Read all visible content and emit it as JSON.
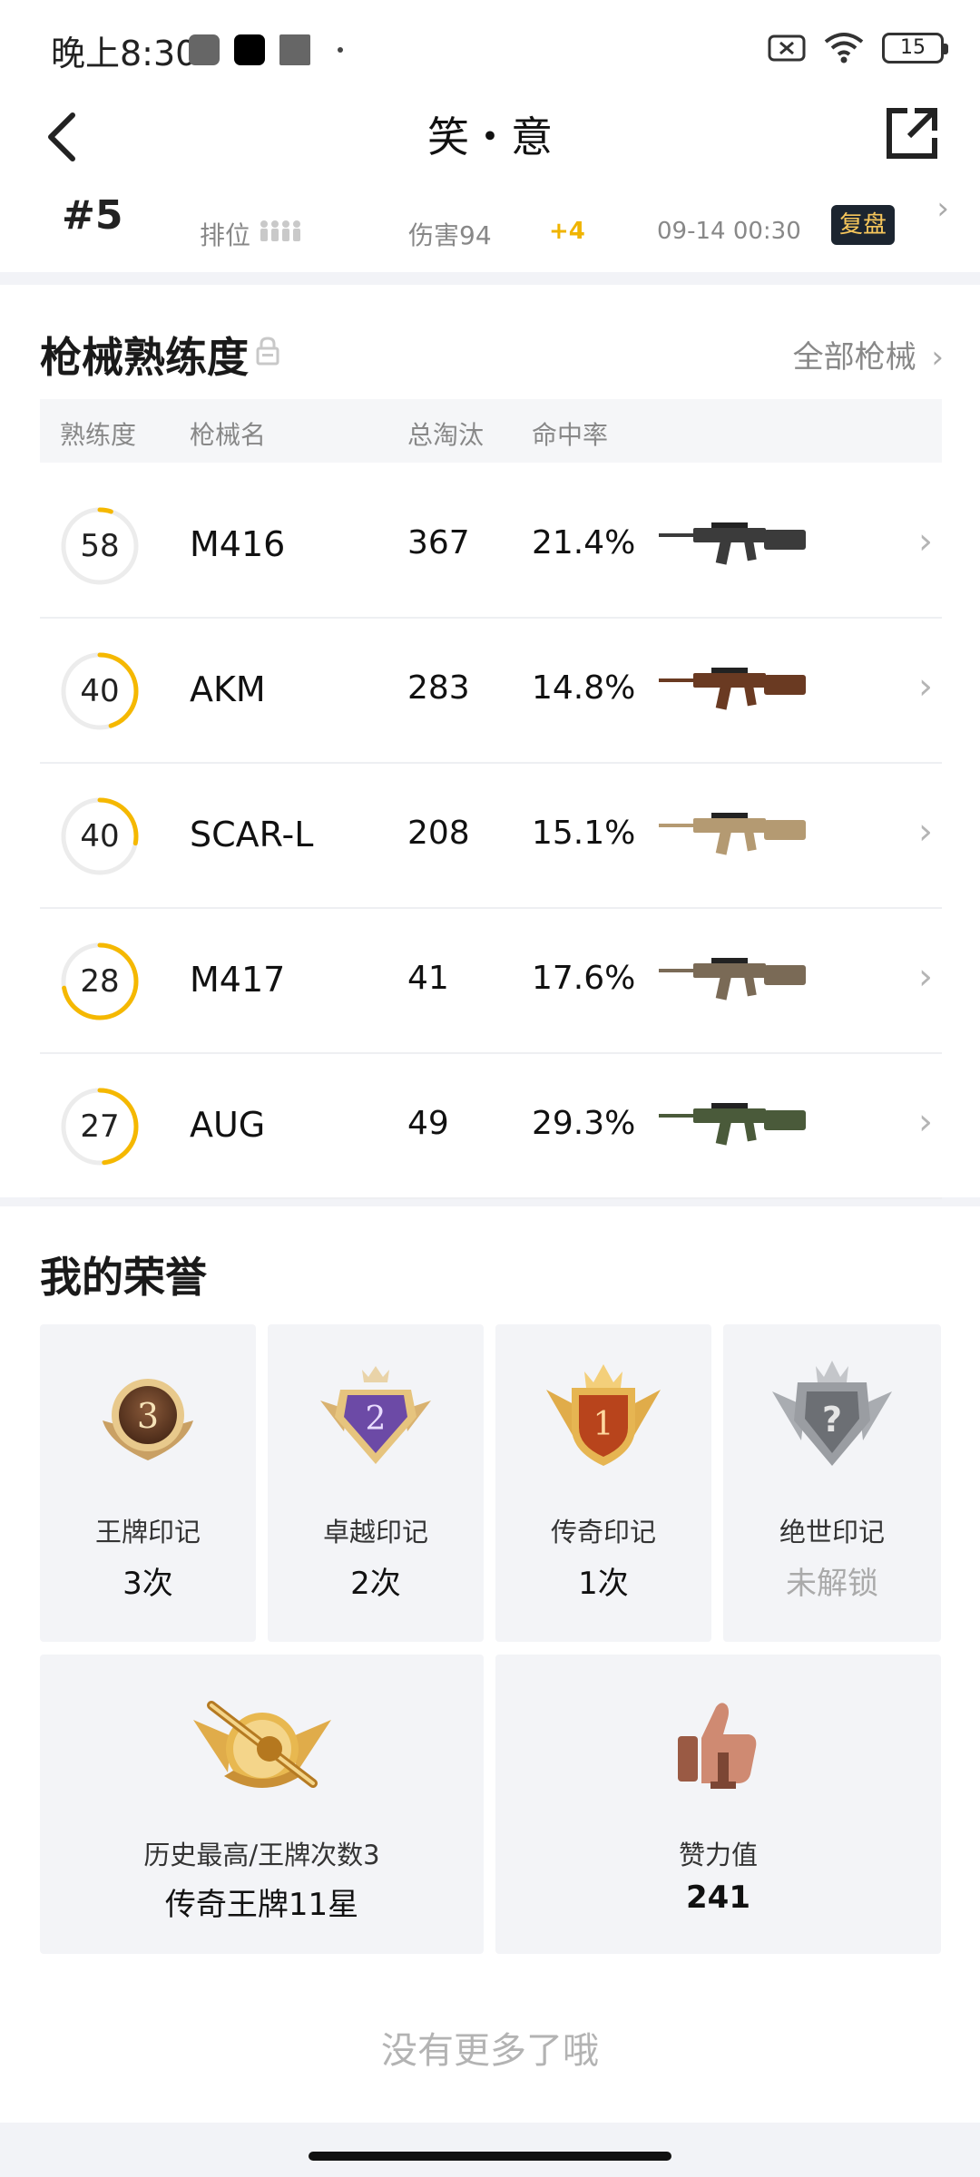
{
  "status": {
    "time": "晚上8:30",
    "battery": "15"
  },
  "header": {
    "title": "笑・意"
  },
  "match": {
    "rank": "#5",
    "mode": "排位",
    "damage": "伤害94",
    "points": "+4",
    "time": "09-14 00:30",
    "replay": "复盘"
  },
  "guns": {
    "title": "枪械熟练度",
    "all_link": "全部枪械",
    "columns": [
      "熟练度",
      "枪械名",
      "总淘汰",
      "命中率"
    ],
    "rows": [
      {
        "level": "58",
        "name": "M416",
        "kills": "367",
        "accuracy": "21.4%",
        "progress": 0.05
      },
      {
        "level": "40",
        "name": "AKM",
        "kills": "283",
        "accuracy": "14.8%",
        "progress": 0.45
      },
      {
        "level": "40",
        "name": "SCAR-L",
        "kills": "208",
        "accuracy": "15.1%",
        "progress": 0.28
      },
      {
        "level": "28",
        "name": "M417",
        "kills": "41",
        "accuracy": "17.6%",
        "progress": 0.72
      },
      {
        "level": "27",
        "name": "AUG",
        "kills": "49",
        "accuracy": "29.3%",
        "progress": 0.48
      }
    ]
  },
  "honors": {
    "title": "我的荣誉",
    "cards": [
      {
        "label": "王牌印记",
        "value": "3次",
        "badge_num": "3"
      },
      {
        "label": "卓越印记",
        "value": "2次",
        "badge_num": "2"
      },
      {
        "label": "传奇印记",
        "value": "1次",
        "badge_num": "1"
      },
      {
        "label": "绝世印记",
        "value": "未解锁",
        "badge_num": "?"
      }
    ],
    "wide_cards": [
      {
        "label": "历史最高/王牌次数3",
        "value": "传奇王牌11星"
      },
      {
        "label": "赞力值",
        "value": "241"
      }
    ]
  },
  "footer": {
    "text": "没有更多了哦"
  },
  "colors": {
    "accent": "#f5b800",
    "ring_track": "#ececec"
  }
}
